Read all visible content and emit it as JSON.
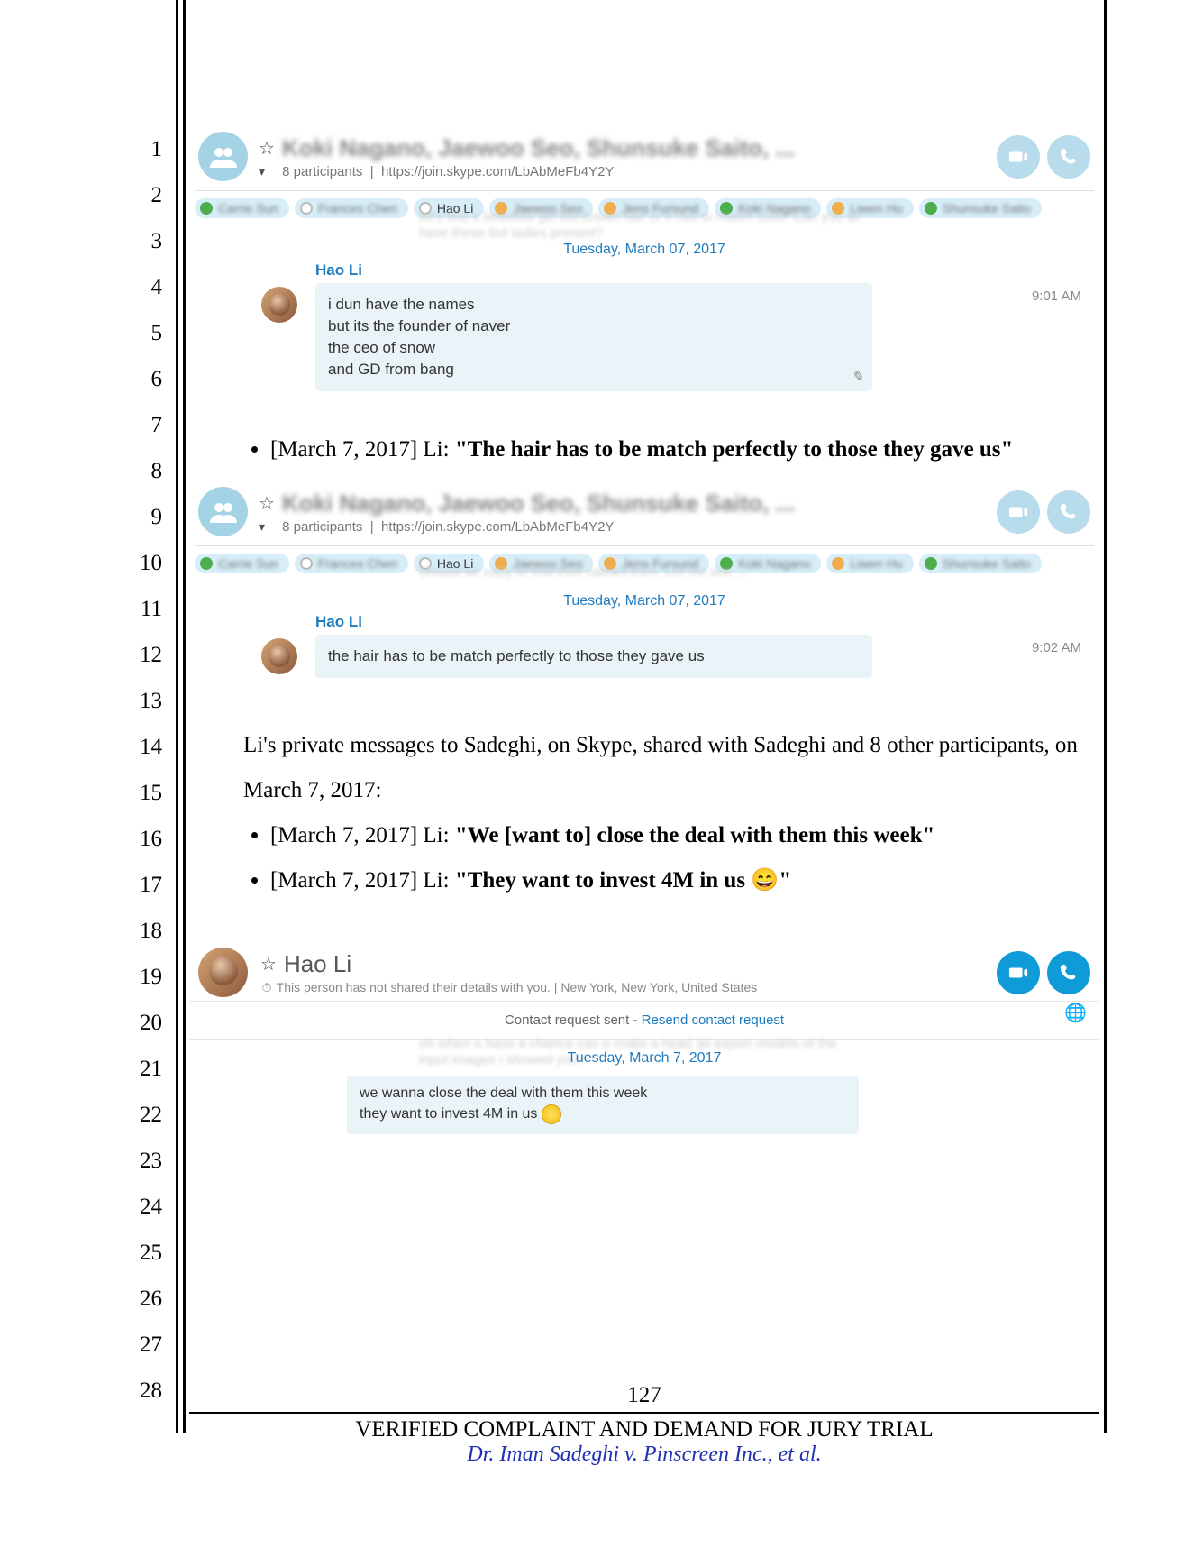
{
  "lineNumbers": [
    "1",
    "2",
    "3",
    "4",
    "5",
    "6",
    "7",
    "8",
    "9",
    "10",
    "11",
    "12",
    "13",
    "14",
    "15",
    "16",
    "17",
    "18",
    "19",
    "20",
    "21",
    "22",
    "23",
    "24",
    "25",
    "26",
    "27",
    "28"
  ],
  "skype1": {
    "blurredTitle": "Koki Nagano, Jaewoo Seo, Shunsuke Saito, ...",
    "participants": "8 participants",
    "link": "https://join.skype.com/LbAbMeFb4Y2Y",
    "pills": [
      "Carrie Sun",
      "Frances Chen",
      "Hao Li",
      "Jaewoo Seo",
      "Jens Fursund",
      "Koki Nagano",
      "Liwen Hu",
      "Shunsuke Saito"
    ],
    "date": "Tuesday, March 07, 2017",
    "sender": "Hao Li",
    "messages": [
      "i dun have the names",
      "but its the founder of naver",
      "the ceo of snow",
      "and GD from bang"
    ],
    "time": "9:01 AM"
  },
  "bullet1": {
    "prefix": "[March 7, 2017] Li: ",
    "quote": "\"The hair has to be match perfectly to those they gave us\""
  },
  "skype2": {
    "blurredTitle": "Koki Nagano, Jaewoo Seo, Shunsuke Saito, ...",
    "participants": "8 participants",
    "link": "https://join.skype.com/LbAbMeFb4Y2Y",
    "pills": [
      "Carrie Sun",
      "Frances Chen",
      "Hao Li",
      "Jaewoo Seo",
      "Jens Fursund",
      "Koki Nagano",
      "Liwen Hu",
      "Shunsuke Saito"
    ],
    "date": "Tuesday, March 07, 2017",
    "sender": "Hao Li",
    "messages": [
      "the hair has to be match perfectly to those they gave us"
    ],
    "time": "9:02 AM"
  },
  "para2": "Li's private messages to Sadeghi, on Skype, shared with Sadeghi and 8 other participants, on March 7, 2017:",
  "bullet2": {
    "prefix": "[March 7, 2017] Li: ",
    "quote": "\"We [want to] close the deal with them this week\""
  },
  "bullet3": {
    "prefix": "[March 7, 2017] Li: ",
    "quote": "\"They want to invest 4M in us 😄\""
  },
  "contact": {
    "name": "Hao Li",
    "sub": "This person has not shared their details with you.  |  New York, New York, United States",
    "requestPrefix": "Contact request sent - ",
    "requestLink": "Resend contact request",
    "date": "Tuesday, March 7, 2017",
    "messages": [
      "we wanna close the deal with them this week",
      "they want to invest 4M in us"
    ]
  },
  "footer": {
    "pageNum": "127",
    "title": "VERIFIED COMPLAINT AND DEMAND FOR JURY TRIAL",
    "case": "Dr. Iman Sadeghi v. Pinscreen Inc., et al."
  }
}
